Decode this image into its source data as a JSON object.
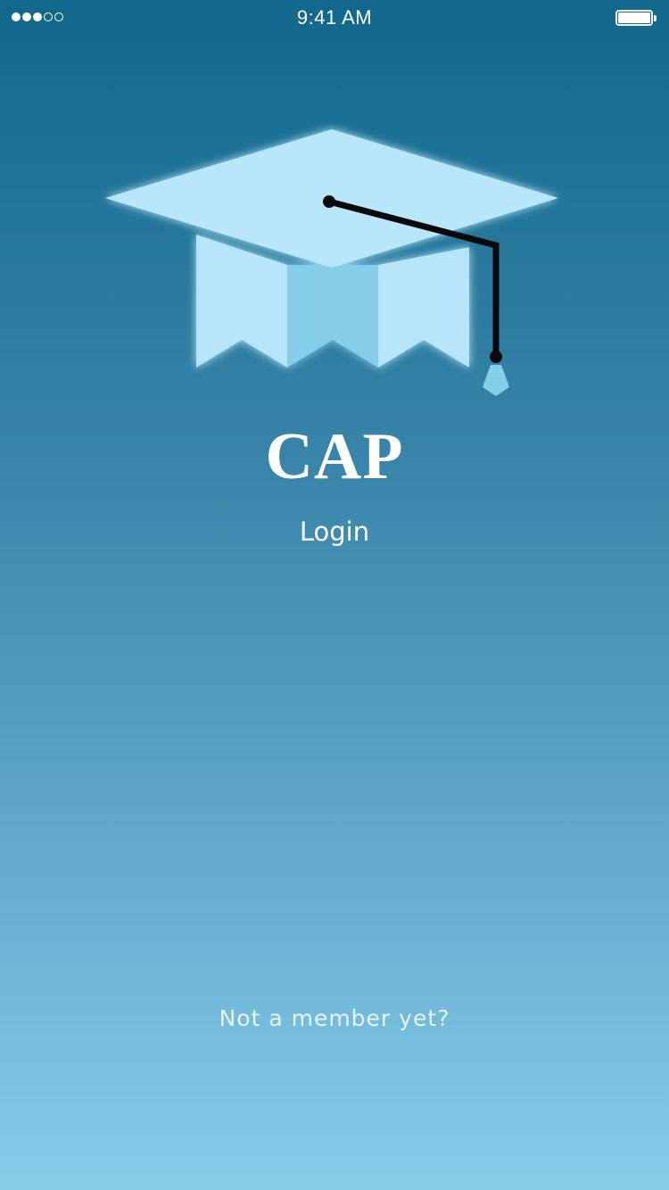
{
  "status_bar": {
    "time": "9:41 AM",
    "signal_bars_filled": 3,
    "signal_bars_total": 5,
    "battery_level": 1.0
  },
  "logo": {
    "icon": "graduation-cap-icon",
    "colors": {
      "cap_light": "#b8e6fa",
      "cap_mid": "#86cdea",
      "tassel": "#0a0a0a"
    }
  },
  "app": {
    "title": "CAP"
  },
  "actions": {
    "login_label": "Login",
    "signup_label": "Not a member yet?"
  },
  "theme": {
    "gradient_top": "#11688c",
    "gradient_bottom": "#86cdea",
    "text_color": "#ffffff"
  }
}
